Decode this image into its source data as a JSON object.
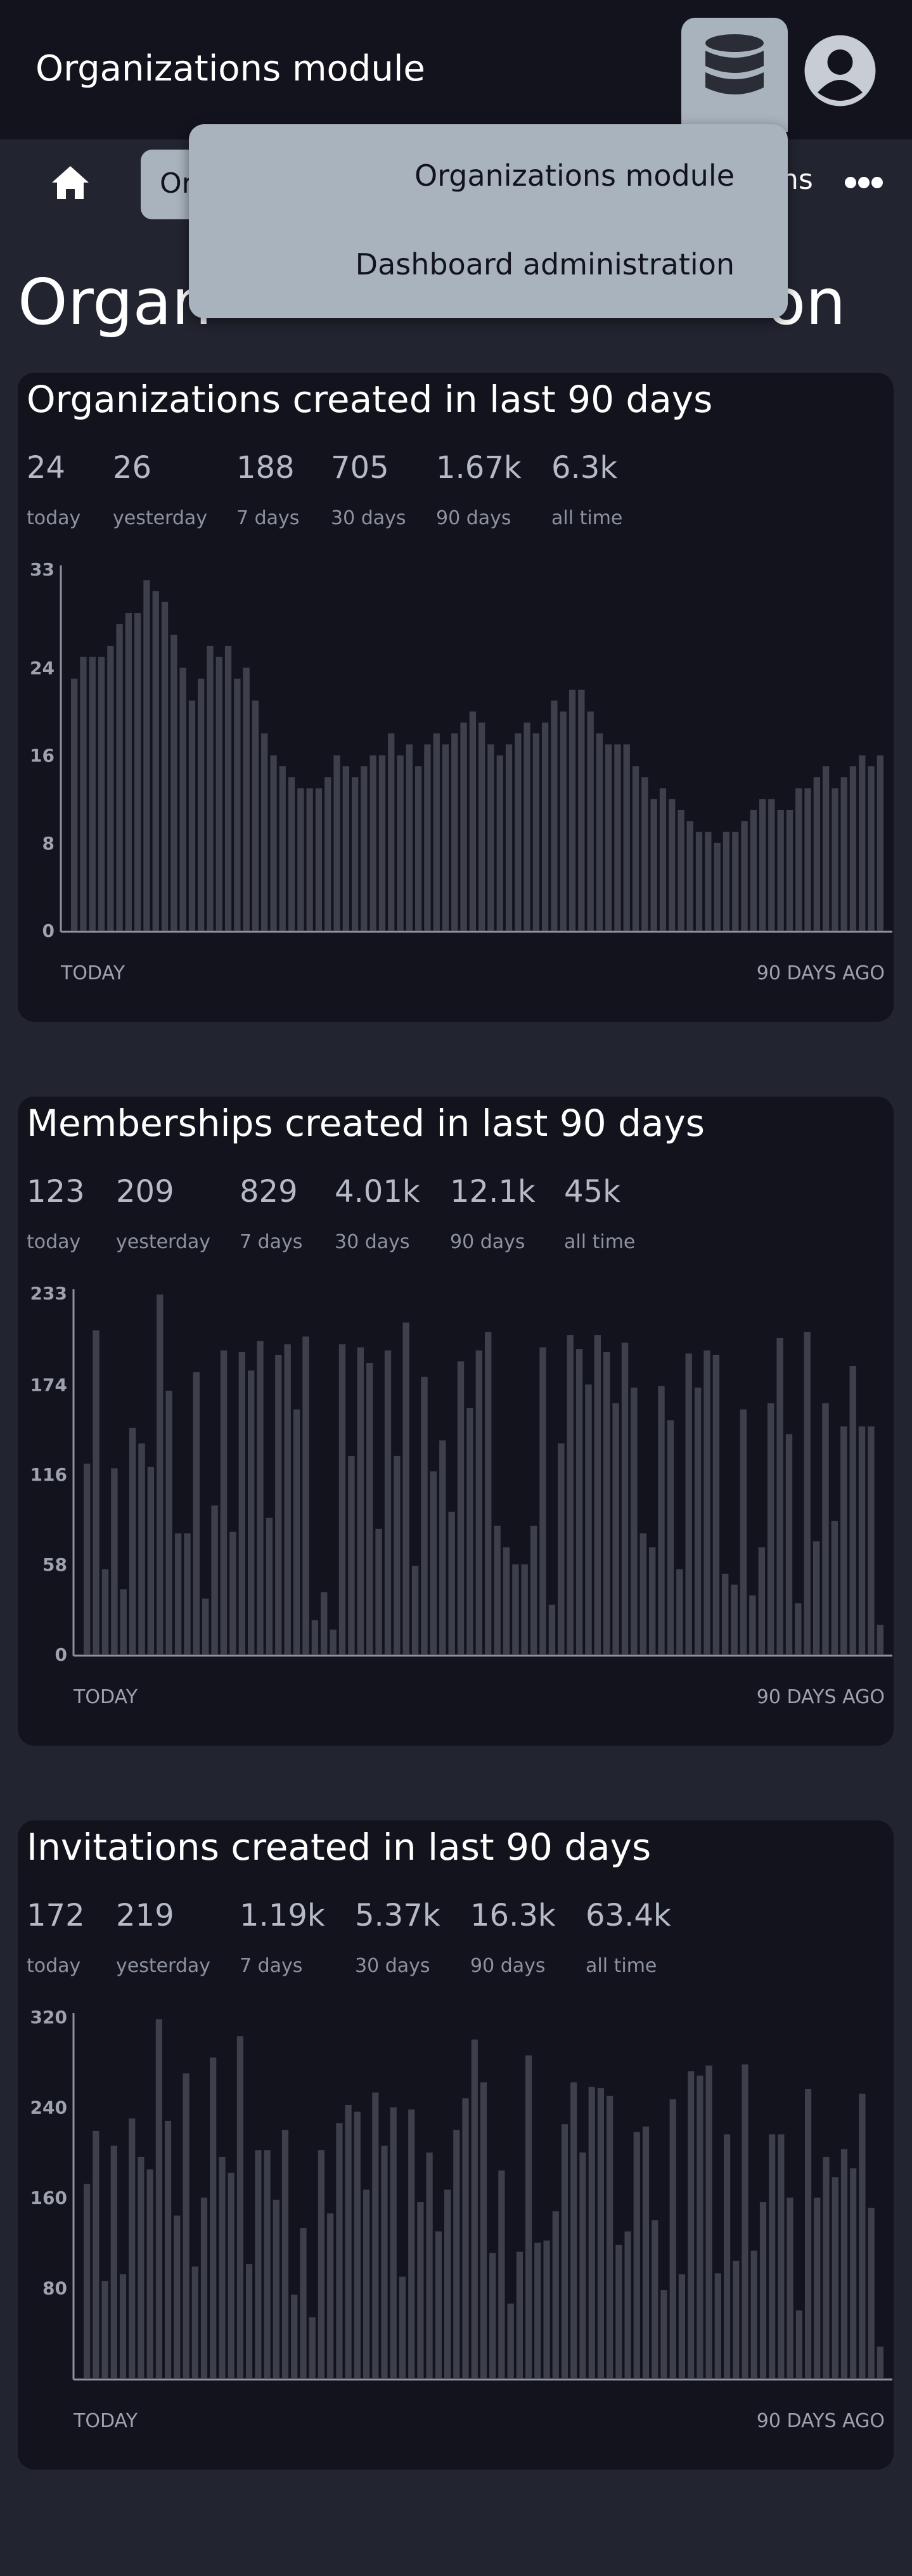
{
  "header": {
    "app_title": "Organizations module",
    "nav_pill_text": "Or",
    "nav_right_text": "ns",
    "page_heading_left": "Organ",
    "page_heading_right": "on"
  },
  "dropdown": {
    "items": [
      "Organizations module",
      "Dashboard administration"
    ]
  },
  "icons": {
    "database": "database-icon",
    "avatar": "user-avatar-icon",
    "home": "home-icon",
    "more": "more-dots-icon"
  },
  "colors": {
    "background": "#222430",
    "card": "#12131c",
    "bar": "#3d3f4a",
    "menu": "#a9b3bd"
  },
  "cards": [
    {
      "title": "Organizations created in last 90 days",
      "stats": [
        {
          "value": "24",
          "label": "today"
        },
        {
          "value": "26",
          "label": "yesterday"
        },
        {
          "value": "188",
          "label": "7 days"
        },
        {
          "value": "705",
          "label": "30 days"
        },
        {
          "value": "1.67k",
          "label": "90 days"
        },
        {
          "value": "6.3k",
          "label": "all time"
        }
      ],
      "axis_left": "TODAY",
      "axis_right": "90 DAYS AGO"
    },
    {
      "title": "Memberships created in last 90 days",
      "stats": [
        {
          "value": "123",
          "label": "today"
        },
        {
          "value": "209",
          "label": "yesterday"
        },
        {
          "value": "829",
          "label": "7 days"
        },
        {
          "value": "4.01k",
          "label": "30 days"
        },
        {
          "value": "12.1k",
          "label": "90 days"
        },
        {
          "value": "45k",
          "label": "all time"
        }
      ],
      "axis_left": "TODAY",
      "axis_right": "90 DAYS AGO"
    },
    {
      "title": "Invitations created in last 90 days",
      "stats": [
        {
          "value": "172",
          "label": "today"
        },
        {
          "value": "219",
          "label": "yesterday"
        },
        {
          "value": "1.19k",
          "label": "7 days"
        },
        {
          "value": "5.37k",
          "label": "30 days"
        },
        {
          "value": "16.3k",
          "label": "90 days"
        },
        {
          "value": "63.4k",
          "label": "all time"
        }
      ],
      "axis_left": "TODAY",
      "axis_right": "90 DAYS AGO"
    }
  ],
  "chart_data": [
    {
      "type": "bar",
      "title": "Organizations created in last 90 days",
      "ylim": [
        0,
        33
      ],
      "yticks": [
        0,
        8,
        16,
        24,
        33
      ],
      "xlabel_left": "TODAY",
      "xlabel_right": "90 DAYS AGO",
      "values": [
        23,
        25,
        25,
        25,
        26,
        28,
        29,
        29,
        32,
        31,
        30,
        27,
        24,
        21,
        23,
        26,
        25,
        26,
        23,
        24,
        21,
        18,
        16,
        15,
        14,
        13,
        13,
        13,
        14,
        16,
        15,
        14,
        15,
        16,
        16,
        18,
        16,
        17,
        15,
        17,
        18,
        17,
        18,
        19,
        20,
        19,
        17,
        16,
        17,
        18,
        19,
        18,
        19,
        21,
        20,
        22,
        22,
        20,
        18,
        17,
        17,
        17,
        15,
        14,
        12,
        13,
        12,
        11,
        10,
        9,
        9,
        8,
        9,
        9,
        10,
        11,
        12,
        12,
        11,
        11,
        13,
        13,
        14,
        15,
        13,
        14,
        15,
        16,
        15,
        16
      ]
    },
    {
      "type": "bar",
      "title": "Memberships created in last 90 days",
      "ylim": [
        0,
        233
      ],
      "yticks": [
        0,
        58,
        116,
        174,
        233
      ],
      "xlabel_left": "TODAY",
      "xlabel_right": "90 DAYS AGO",
      "values": [
        123,
        209,
        55,
        120,
        42,
        146,
        136,
        121,
        232,
        170,
        78,
        78,
        182,
        36,
        96,
        196,
        79,
        195,
        183,
        202,
        88,
        193,
        200,
        158,
        205,
        22,
        40,
        16,
        200,
        128,
        198,
        188,
        81,
        196,
        128,
        214,
        57,
        179,
        118,
        138,
        92,
        189,
        159,
        196,
        208,
        83,
        69,
        58,
        58,
        83,
        198,
        32,
        136,
        206,
        197,
        174,
        206,
        195,
        162,
        201,
        172,
        78,
        69,
        173,
        151,
        55,
        194,
        172,
        196,
        193,
        52,
        45,
        158,
        38,
        69,
        162,
        204,
        142,
        33,
        208,
        73,
        162,
        86,
        147,
        186,
        147,
        147,
        19
      ]
    },
    {
      "type": "bar",
      "title": "Invitations created in last 90 days",
      "ylim": [
        0,
        320
      ],
      "yticks": [
        80,
        160,
        240,
        320
      ],
      "xlabel_left": "TODAY",
      "xlabel_right": "90 DAYS AGO",
      "values": [
        172,
        219,
        86,
        206,
        92,
        230,
        196,
        185,
        318,
        228,
        144,
        270,
        99,
        160,
        284,
        196,
        182,
        303,
        101,
        202,
        202,
        158,
        220,
        74,
        133,
        54,
        202,
        146,
        226,
        242,
        236,
        167,
        253,
        206,
        240,
        90,
        238,
        156,
        200,
        130,
        167,
        220,
        248,
        300,
        262,
        111,
        184,
        66,
        112,
        286,
        120,
        122,
        148,
        225,
        262,
        200,
        258,
        257,
        250,
        118,
        130,
        218,
        223,
        140,
        78,
        247,
        92,
        272,
        268,
        277,
        93,
        216,
        104,
        278,
        113,
        156,
        216,
        216,
        160,
        60,
        256,
        160,
        196,
        178,
        203,
        186,
        252,
        151,
        28
      ]
    }
  ]
}
